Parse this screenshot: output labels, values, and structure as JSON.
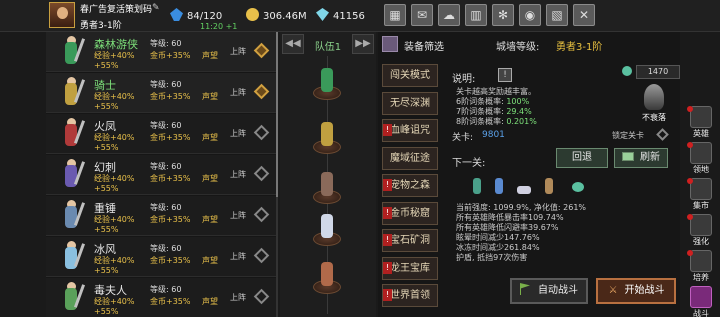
{
  "player": {
    "name": "春广告复活策划码",
    "stage": "勇者3-1阶",
    "clock": "11:20 +1"
  },
  "resources": {
    "stamina": "84/120",
    "gold": "306.46M",
    "diamond": "41156"
  },
  "top_menu": [
    {
      "name": "shop-icon",
      "glyph": "▦"
    },
    {
      "name": "mail-icon",
      "glyph": "✉"
    },
    {
      "name": "chat-icon",
      "glyph": "☁"
    },
    {
      "name": "gift-icon",
      "glyph": "▥"
    },
    {
      "name": "settings-icon",
      "glyph": "✻"
    },
    {
      "name": "wheel-icon",
      "glyph": "◉"
    },
    {
      "name": "pass-icon",
      "glyph": "▧"
    },
    {
      "name": "close-icon",
      "glyph": "✕"
    }
  ],
  "hero_list": {
    "level_prefix": "等级: 60",
    "exp_text": "经验+40%",
    "gold_text": "金币+35%",
    "reputation_text": "声望",
    "exp_bonus2": "+55%",
    "deploy_label": "上阵",
    "heroes": [
      {
        "name": "森林游侠",
        "level": "等级: 60",
        "active": true,
        "deployed": true,
        "color": "#3a9a5a"
      },
      {
        "name": "骑士",
        "level": "等级: 60",
        "active": true,
        "deployed": true,
        "color": "#c0a040"
      },
      {
        "name": "火凤",
        "level": "等级: 60",
        "active": false,
        "deployed": false,
        "color": "#b03a3a"
      },
      {
        "name": "幻刺",
        "level": "等级: 60",
        "active": false,
        "deployed": false,
        "color": "#6a5ab0"
      },
      {
        "name": "重锤",
        "level": "等级: 60",
        "active": false,
        "deployed": false,
        "color": "#6a8ab0"
      },
      {
        "name": "冰风",
        "level": "等级: 60",
        "active": false,
        "deployed": false,
        "color": "#8ac0e0"
      },
      {
        "name": "毒夫人",
        "level": "等级: 60",
        "active": false,
        "deployed": false,
        "color": "#5aa05a"
      }
    ]
  },
  "team": {
    "title": "队伍1"
  },
  "right": {
    "filter_label": "装备筛选",
    "fort_label": "城墙等级:",
    "fort_value": "勇者3-1阶",
    "modes": [
      {
        "label": "闯关模式",
        "locked": false
      },
      {
        "label": "无尽深渊",
        "locked": false
      },
      {
        "label": "血峰诅咒",
        "locked": true
      },
      {
        "label": "魔域征途",
        "locked": false
      },
      {
        "label": "宠物之森",
        "locked": true
      },
      {
        "label": "金币秘窟",
        "locked": true
      },
      {
        "label": "宝石矿洞",
        "locked": true
      },
      {
        "label": "龙王宝库",
        "locked": true
      },
      {
        "label": "世界首领",
        "locked": true
      }
    ],
    "explain_label": "说明:",
    "explain_lines": [
      {
        "text": "关卡越高奖励越丰富。",
        "value": ""
      },
      {
        "text": "6阶词条概率: ",
        "value": "100%"
      },
      {
        "text": "7阶词条概率: ",
        "value": "29.4%"
      },
      {
        "text": "8阶词条概率: ",
        "value": "0.201%"
      }
    ],
    "monster_count": "1470",
    "no_fall_label": "不衰落",
    "stage_label": "关卡:",
    "stage_value": "9801",
    "lock_label": "锁定关卡",
    "next_label": "下一关:",
    "retreat_label": "回退",
    "refresh_label": "刷新",
    "stats": [
      "当前强度: 1099.9%, 净化值: 261%",
      "所有英雄降低暴击率109.74%",
      "所有英雄降低闪避率39.67%",
      "眩晕时间减少147.76%",
      "冰冻时间减少261.84%",
      "护盾, 抵挡97次伤害"
    ],
    "auto_label": "自动战斗",
    "start_label": "开始战斗"
  },
  "side_nav": [
    {
      "label": "英雄",
      "name": "nav-hero",
      "dot": true,
      "active": false
    },
    {
      "label": "领地",
      "name": "nav-territory",
      "dot": true,
      "active": false
    },
    {
      "label": "集市",
      "name": "nav-market",
      "dot": true,
      "active": false
    },
    {
      "label": "强化",
      "name": "nav-enhance",
      "dot": true,
      "active": false
    },
    {
      "label": "培养",
      "name": "nav-train",
      "dot": true,
      "active": false
    },
    {
      "label": "战斗",
      "name": "nav-battle",
      "dot": false,
      "active": true
    }
  ]
}
